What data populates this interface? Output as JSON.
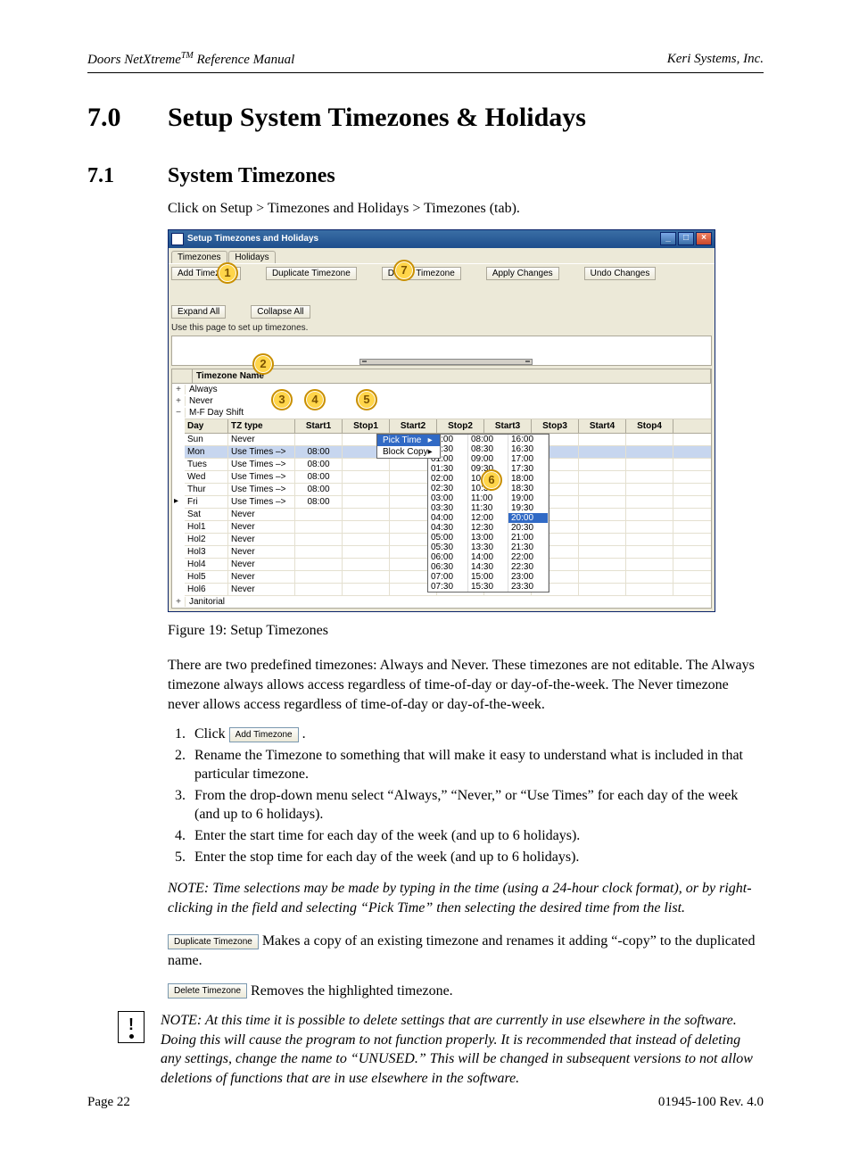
{
  "header": {
    "left_prefix": "Doors NetXtreme",
    "left_tm": "TM",
    "left_suffix": " Reference Manual",
    "right": "Keri Systems, Inc."
  },
  "h1": {
    "num": "7.0",
    "title": "Setup System Timezones & Holidays"
  },
  "h2": {
    "num": "7.1",
    "title": "System Timezones"
  },
  "intro": "Click on Setup > Timezones and Holidays > Timezones (tab).",
  "window": {
    "title": "Setup Timezones and Holidays",
    "tabs": [
      "Timezones",
      "Holidays"
    ],
    "toolbar": [
      "Add Timezone",
      "Duplicate Timezone",
      "Delete Timezone",
      "Apply Changes",
      "Undo Changes",
      "Expand All",
      "Collapse All"
    ],
    "hint": "Use this page to set up timezones.",
    "group_header": "Timezone Name",
    "nodes": [
      {
        "exp": "+",
        "label": "Always"
      },
      {
        "exp": "+",
        "label": "Never"
      },
      {
        "exp": "−",
        "label": "M-F Day Shift"
      }
    ],
    "sub_headers": [
      "Day",
      "TZ type",
      "Start1",
      "Stop1",
      "Start2",
      "Stop2",
      "Start3",
      "Stop3",
      "Start4",
      "Stop4"
    ],
    "sub_rows": [
      {
        "day": "Sun",
        "tz": "Never",
        "s1": "",
        "p1": ""
      },
      {
        "day": "Mon",
        "tz": "Use Times –>",
        "s1": "08:00",
        "p1": "",
        "hl": true
      },
      {
        "day": "Tues",
        "tz": "Use Times –>",
        "s1": "08:00",
        "p1": ""
      },
      {
        "day": "Wed",
        "tz": "Use Times –>",
        "s1": "08:00",
        "p1": ""
      },
      {
        "day": "Thur",
        "tz": "Use Times –>",
        "s1": "08:00",
        "p1": ""
      },
      {
        "day": "Fri",
        "tz": "Use Times –>",
        "s1": "08:00",
        "p1": ""
      },
      {
        "day": "Sat",
        "tz": "Never",
        "s1": "",
        "p1": ""
      },
      {
        "day": "Hol1",
        "tz": "Never",
        "s1": "",
        "p1": ""
      },
      {
        "day": "Hol2",
        "tz": "Never",
        "s1": "",
        "p1": ""
      },
      {
        "day": "Hol3",
        "tz": "Never",
        "s1": "",
        "p1": ""
      },
      {
        "day": "Hol4",
        "tz": "Never",
        "s1": "",
        "p1": ""
      },
      {
        "day": "Hol5",
        "tz": "Never",
        "s1": "",
        "p1": ""
      },
      {
        "day": "Hol6",
        "tz": "Never",
        "s1": "",
        "p1": ""
      }
    ],
    "last_node": {
      "exp": "+",
      "label": "Janitorial"
    },
    "context_menu": {
      "items": [
        "Pick Time",
        "Block Copy"
      ],
      "arrow": "▸"
    },
    "time_picker": {
      "rows": [
        [
          "00:00",
          "08:00",
          "16:00"
        ],
        [
          "00:30",
          "08:30",
          "16:30"
        ],
        [
          "01:00",
          "09:00",
          "17:00"
        ],
        [
          "01:30",
          "09:30",
          "17:30"
        ],
        [
          "02:00",
          "10:00",
          "18:00"
        ],
        [
          "02:30",
          "10:30",
          "18:30"
        ],
        [
          "03:00",
          "11:00",
          "19:00"
        ],
        [
          "03:30",
          "11:30",
          "19:30"
        ],
        [
          "04:00",
          "12:00",
          "20:00"
        ],
        [
          "04:30",
          "12:30",
          "20:30"
        ],
        [
          "05:00",
          "13:00",
          "21:00"
        ],
        [
          "05:30",
          "13:30",
          "21:30"
        ],
        [
          "06:00",
          "14:00",
          "22:00"
        ],
        [
          "06:30",
          "14:30",
          "22:30"
        ],
        [
          "07:00",
          "15:00",
          "23:00"
        ],
        [
          "07:30",
          "15:30",
          "23:30"
        ]
      ],
      "highlight": {
        "row": 8,
        "col": 2,
        "value": "20:00"
      }
    },
    "callouts": {
      "1": "1",
      "2": "2",
      "3": "3",
      "4": "4",
      "5": "5",
      "6": "6",
      "7": "7"
    }
  },
  "figure_caption": "Figure 19: Setup Timezones",
  "para_predef": "There are two predefined timezones: Always and Never. These timezones are not editable. The Always timezone always allows access regardless of time-of-day or day-of-the-week. The Never timezone never allows access regardless of time-of-day or day-of-the-week.",
  "steps_prefix": "Click ",
  "steps_button": "Add Timezone",
  "steps_suffix": ".",
  "steps": [
    "Rename the Timezone to something that will make it easy to understand what is included in that particular timezone.",
    "From the drop-down menu select “Always,” “Never,” or “Use Times” for each day of the week (and up to 6 holidays).",
    "Enter the start time for each day of the week (and up to 6 holidays).",
    "Enter the stop time for each day of the week (and up to 6 holidays)."
  ],
  "note1": "NOTE: Time selections may be made by typing in the time (using a 24-hour clock format), or by right-clicking in the field and selecting “Pick Time” then selecting the desired time from the list.",
  "dup_btn": "Duplicate Timezone",
  "dup_text": " Makes a copy of an existing timezone and renames it adding “-copy” to the duplicated name.",
  "del_btn": "Delete Timezone",
  "del_text": " Removes the highlighted timezone.",
  "note2": "NOTE: At this time it is possible to delete settings that are currently in use elsewhere in the software. Doing this will cause the program to not function properly. It is recommended that instead of deleting any settings, change the name to “UNUSED.” This will be changed in subsequent versions to not allow deletions of functions that are in use elsewhere in the software.",
  "footer": {
    "left": "Page 22",
    "right": "01945-100  Rev. 4.0"
  }
}
